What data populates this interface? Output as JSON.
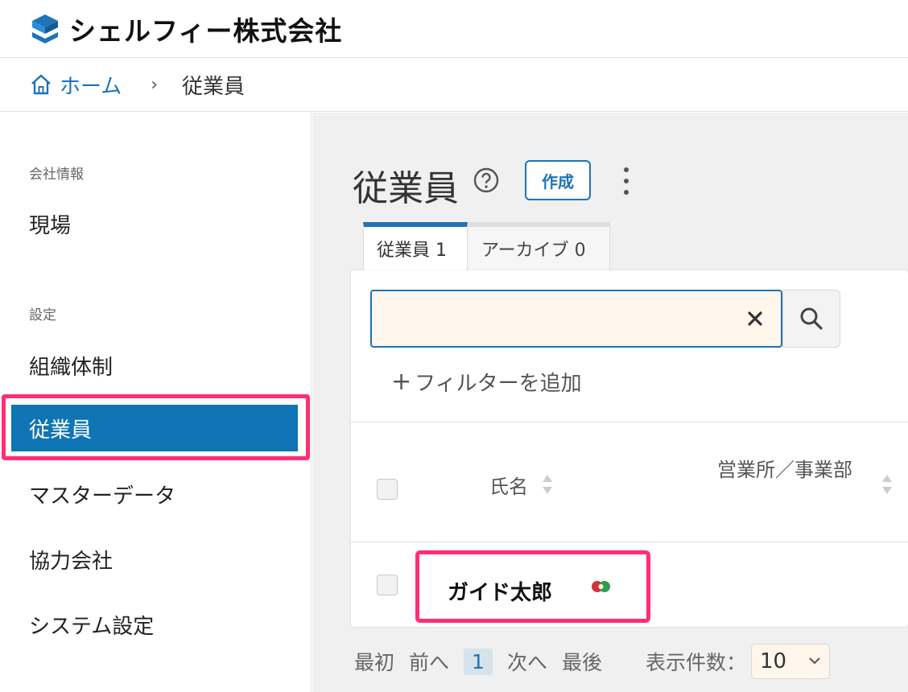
{
  "header": {
    "company": "シェルフィー株式会社",
    "logo_icon": "shelfy-logo-icon"
  },
  "breadcrumb": {
    "home": "ホーム",
    "separator": "›",
    "current": "従業員"
  },
  "sidebar": {
    "section_company": "会社情報",
    "item_genba": "現場",
    "section_settings": "設定",
    "item_org": "組織体制",
    "item_employees": "従業員",
    "item_master": "マスターデータ",
    "item_partner": "協力会社",
    "item_system": "システム設定"
  },
  "main": {
    "title": "従業員",
    "create_label": "作成",
    "tabs": [
      {
        "label": "従業員 1"
      },
      {
        "label": "アーカイブ 0"
      }
    ],
    "search": {
      "value": "",
      "placeholder": ""
    },
    "add_filter_label": "フィルターを追加",
    "table": {
      "columns": [
        "氏名",
        "営業所／事業部"
      ],
      "rows": [
        {
          "name": "ガイド太郎"
        }
      ]
    },
    "pagination": {
      "first": "最初",
      "prev": "前へ",
      "current": "1",
      "next": "次へ",
      "last": "最後",
      "per_page_label": "表示件数：",
      "per_page_value": "10"
    }
  },
  "colors": {
    "accent": "#1f73b7",
    "active_bg": "#0f75b5",
    "highlight": "#ff2d78",
    "search_bg": "#fff6ec"
  }
}
